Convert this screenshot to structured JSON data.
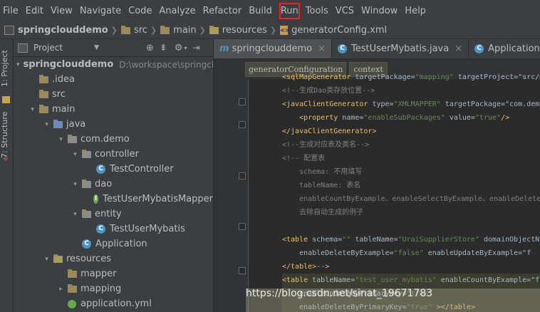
{
  "menu": [
    "File",
    "Edit",
    "View",
    "Navigate",
    "Code",
    "Analyze",
    "Refactor",
    "Build",
    "Run",
    "Tools",
    "VCS",
    "Window",
    "Help"
  ],
  "menu_highlight": "Run",
  "breadcrumbs": [
    "springclouddemo",
    "src",
    "main",
    "resources",
    "generatorConfig.xml"
  ],
  "left_tabs": [
    "1: Project",
    "7: Structure"
  ],
  "panel": {
    "title": "Project"
  },
  "tree": [
    {
      "label": "springclouddemo",
      "path": "D:\\workspace\\springcloudd",
      "icon": "project-folder-icon",
      "level": 0,
      "arrow": "▾"
    },
    {
      "label": ".idea",
      "icon": "folder-icon",
      "level": 1,
      "arrow": ""
    },
    {
      "label": "src",
      "icon": "folder-icon",
      "level": 1,
      "arrow": ""
    },
    {
      "label": "main",
      "icon": "folder-icon",
      "level": 1,
      "arrow": "▾"
    },
    {
      "label": "java",
      "icon": "source-folder-icon",
      "level": 2,
      "arrow": "▾"
    },
    {
      "label": "com.demo",
      "icon": "package-icon",
      "level": 3,
      "arrow": "▾"
    },
    {
      "label": "controller",
      "icon": "package-icon",
      "level": 4,
      "arrow": "▾"
    },
    {
      "label": "TestController",
      "icon": "class-icon",
      "level": 5,
      "arrow": ""
    },
    {
      "label": "dao",
      "icon": "package-icon",
      "level": 4,
      "arrow": "▾"
    },
    {
      "label": "TestUserMybatisMapper",
      "icon": "interface-icon",
      "level": 5,
      "arrow": ""
    },
    {
      "label": "entity",
      "icon": "package-icon",
      "level": 4,
      "arrow": "▾"
    },
    {
      "label": "TestUserMybatis",
      "icon": "class-icon",
      "level": 5,
      "arrow": ""
    },
    {
      "label": "Application",
      "icon": "spring-app-icon",
      "level": 4,
      "arrow": ""
    },
    {
      "label": "resources",
      "icon": "resources-folder-icon",
      "level": 2,
      "arrow": "▾"
    },
    {
      "label": "mapper",
      "icon": "folder-icon",
      "level": 3,
      "arrow": ""
    },
    {
      "label": "mapping",
      "icon": "folder-icon",
      "level": 3,
      "arrow": "▸"
    },
    {
      "label": "application.yml",
      "icon": "yml-icon",
      "level": 3,
      "arrow": ""
    }
  ],
  "tabs": [
    {
      "label": "springclouddemo",
      "icon": "module-icon",
      "close": "×"
    },
    {
      "label": "TestUserMybatis.java",
      "icon": "class-icon",
      "close": "×"
    },
    {
      "label": "Application.java",
      "icon": "class-icon",
      "close": ""
    }
  ],
  "editor_breadcrumbs": [
    "generatorConfiguration",
    "context"
  ],
  "code": [
    "<sqlMapGenerator targetPackage=\"mapping\" targetProject=\"src/m",
    "<!--生成Dao类存放位置-->",
    "<javaClientGenerator type=\"XMLMAPPER\" targetPackage=\"com.demo",
    "    <property name=\"enableSubPackages\" value=\"true\"/>",
    "</javaClientGenerator>",
    "<!--生成对应表及类名-->",
    "<!-- 配置表",
    "    schema: 不用填写",
    "    tableName: 表名",
    "    enableCountByExample、enableSelectByExample、enableDelete",
    "    去除自动生成的例子",
    "",
    "<table schema=\"\" tableName=\"UraiSupplierStore\" domainObjectNa",
    "    enableDeleteByExample=\"false\" enableUpdateByExample=\"f",
    "</table>-->",
    "<table tableName=\"test_user_mybatis\" enableCountByExample=\"fa",
    "    enableUpdateByPrimaryKey=\"true\"",
    "    enableDeleteByPrimaryKey=\"true\" ></table>"
  ],
  "watermark": "https://blog.csdn.net/sinat_19671783",
  "colors": {
    "highlight_box": "#e8232a",
    "bg": "#2b2b2b",
    "panel": "#3c3f41"
  }
}
